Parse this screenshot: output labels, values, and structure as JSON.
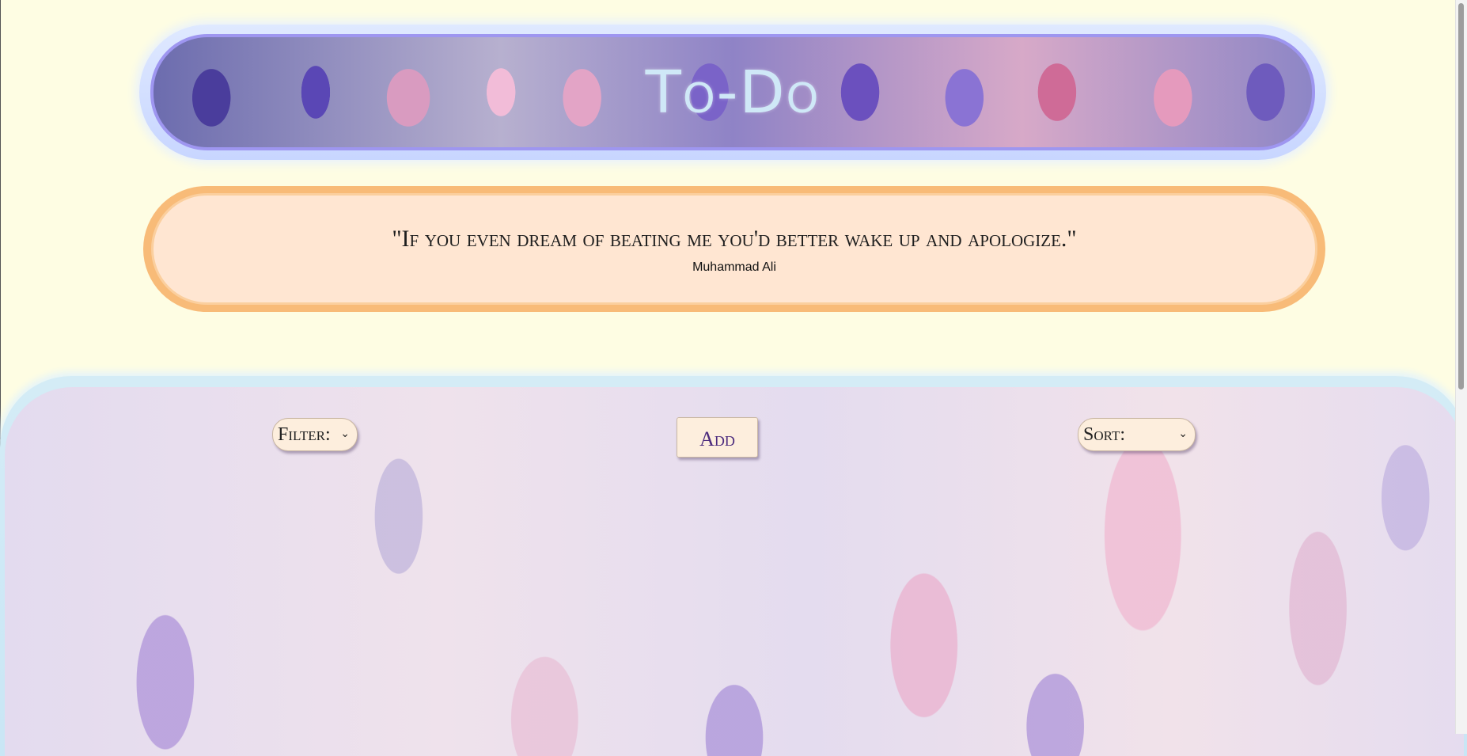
{
  "app": {
    "title": "To-Do"
  },
  "quote": {
    "text": "\"If you even dream of beating me you'd better wake up and apologize.\"",
    "author": "Muhammad Ali"
  },
  "controls": {
    "filter_label": "Filter:",
    "add_label": "Add",
    "sort_label": "Sort:"
  },
  "icons": {
    "filter_chevron": "chevron-down-icon",
    "sort_chevron": "chevron-down-icon"
  },
  "colors": {
    "page_background": "#fefde3",
    "header_border": "#9e96f0",
    "title_color": "#cfe8f7",
    "quote_border": "#f8bb78",
    "quote_background": "#ffe6d2",
    "control_background": "#fdeedd",
    "add_text": "#4b2a7d"
  }
}
